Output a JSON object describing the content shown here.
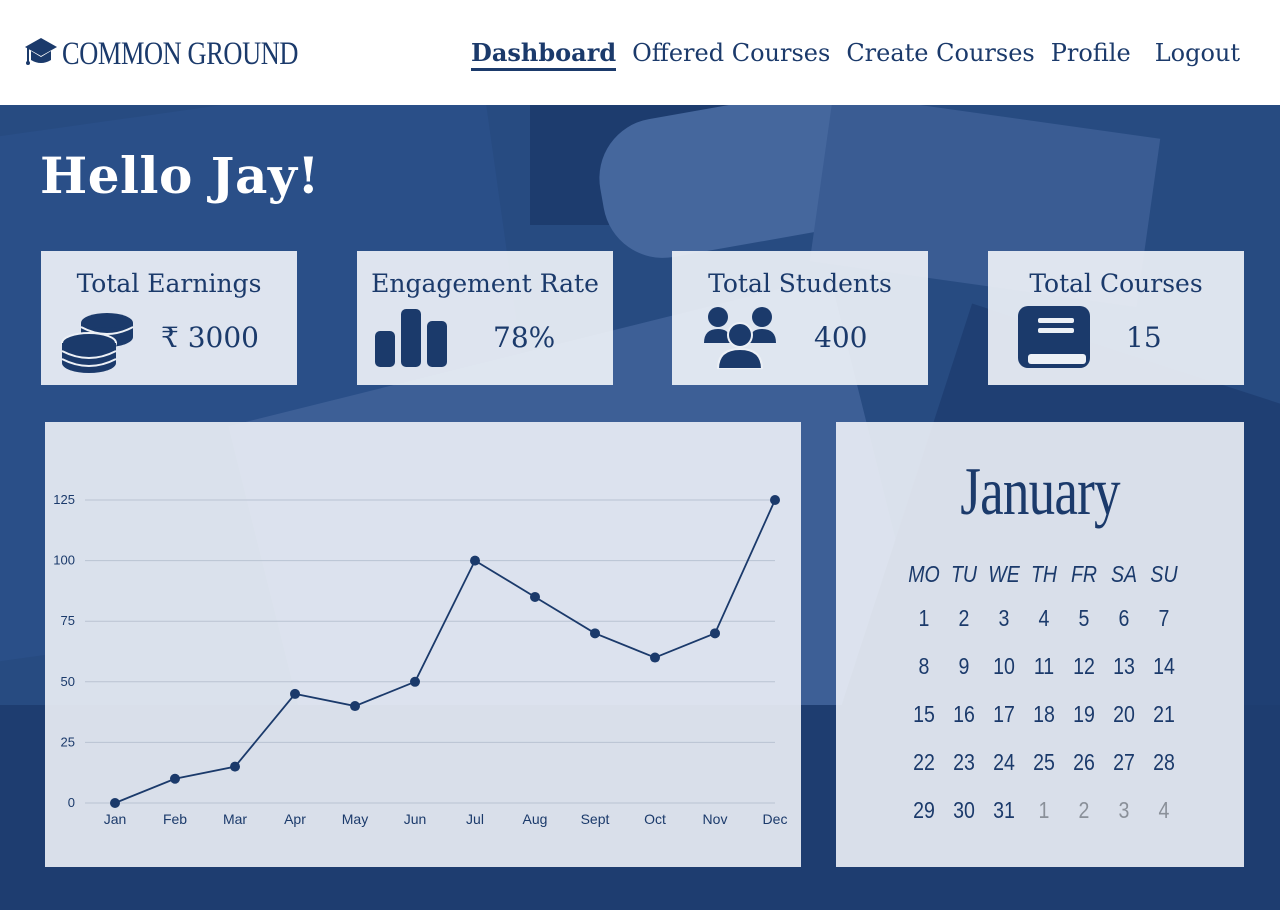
{
  "brand": {
    "name": "COMMON GROUND"
  },
  "nav": {
    "items": [
      {
        "label": "Dashboard",
        "active": true
      },
      {
        "label": "Offered Courses",
        "active": false
      },
      {
        "label": "Create Courses",
        "active": false
      },
      {
        "label": "Profile",
        "active": false
      }
    ],
    "logout": "Logout"
  },
  "greeting": "Hello Jay!",
  "stats": {
    "earnings": {
      "title": "Total Earnings",
      "value": "₹ 3000",
      "icon": "coins-icon"
    },
    "engagement": {
      "title": "Engagement Rate",
      "value": "78%",
      "icon": "bar-chart-icon"
    },
    "students": {
      "title": "Total Students",
      "value": "400",
      "icon": "users-icon"
    },
    "courses": {
      "title": "Total Courses",
      "value": "15",
      "icon": "book-icon"
    }
  },
  "colors": {
    "primary": "#1b3a6b",
    "card_bg": "#ecf0f6",
    "muted_day": "#8a9099"
  },
  "chart_data": {
    "type": "line",
    "categories": [
      "Jan",
      "Feb",
      "Mar",
      "Apr",
      "May",
      "Jun",
      "Jul",
      "Aug",
      "Sept",
      "Oct",
      "Nov",
      "Dec"
    ],
    "values": [
      0,
      10,
      15,
      45,
      40,
      50,
      100,
      85,
      70,
      60,
      70,
      125
    ],
    "yticks": [
      0,
      25,
      50,
      75,
      100,
      125
    ],
    "ylim": [
      0,
      125
    ],
    "title": "",
    "xlabel": "",
    "ylabel": "",
    "grid": true,
    "markers": true
  },
  "calendar": {
    "month": "January",
    "weekdays": [
      "MO",
      "TU",
      "WE",
      "TH",
      "FR",
      "SA",
      "SU"
    ],
    "days": [
      {
        "n": "1",
        "muted": false
      },
      {
        "n": "2",
        "muted": false
      },
      {
        "n": "3",
        "muted": false
      },
      {
        "n": "4",
        "muted": false
      },
      {
        "n": "5",
        "muted": false
      },
      {
        "n": "6",
        "muted": false
      },
      {
        "n": "7",
        "muted": false
      },
      {
        "n": "8",
        "muted": false
      },
      {
        "n": "9",
        "muted": false
      },
      {
        "n": "10",
        "muted": false
      },
      {
        "n": "11",
        "muted": false
      },
      {
        "n": "12",
        "muted": false
      },
      {
        "n": "13",
        "muted": false
      },
      {
        "n": "14",
        "muted": false
      },
      {
        "n": "15",
        "muted": false
      },
      {
        "n": "16",
        "muted": false
      },
      {
        "n": "17",
        "muted": false
      },
      {
        "n": "18",
        "muted": false
      },
      {
        "n": "19",
        "muted": false
      },
      {
        "n": "20",
        "muted": false
      },
      {
        "n": "21",
        "muted": false
      },
      {
        "n": "22",
        "muted": false
      },
      {
        "n": "23",
        "muted": false
      },
      {
        "n": "24",
        "muted": false
      },
      {
        "n": "25",
        "muted": false
      },
      {
        "n": "26",
        "muted": false
      },
      {
        "n": "27",
        "muted": false
      },
      {
        "n": "28",
        "muted": false
      },
      {
        "n": "29",
        "muted": false
      },
      {
        "n": "30",
        "muted": false
      },
      {
        "n": "31",
        "muted": false
      },
      {
        "n": "1",
        "muted": true
      },
      {
        "n": "2",
        "muted": true
      },
      {
        "n": "3",
        "muted": true
      },
      {
        "n": "4",
        "muted": true
      }
    ]
  }
}
